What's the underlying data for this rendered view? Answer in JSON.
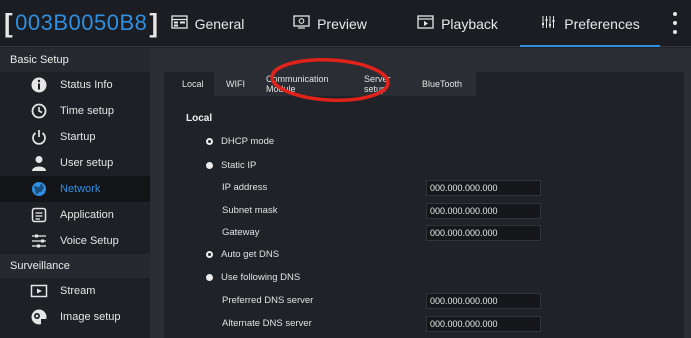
{
  "header": {
    "device_id": "003B0050B8",
    "tabs": [
      {
        "label": "General",
        "icon": "general-icon",
        "active": false
      },
      {
        "label": "Preview",
        "icon": "preview-icon",
        "active": false
      },
      {
        "label": "Playback",
        "icon": "playback-icon",
        "active": false
      },
      {
        "label": "Preferences",
        "icon": "preferences-icon",
        "active": true
      }
    ]
  },
  "sidebar": {
    "groups": [
      {
        "label": "Basic Setup",
        "items": [
          {
            "label": "Status Info",
            "icon": "info-icon"
          },
          {
            "label": "Time setup",
            "icon": "clock-icon"
          },
          {
            "label": "Startup",
            "icon": "power-icon"
          },
          {
            "label": "User setup",
            "icon": "user-icon"
          },
          {
            "label": "Network",
            "icon": "globe-icon",
            "active": true
          },
          {
            "label": "Application",
            "icon": "application-icon"
          },
          {
            "label": "Voice Setup",
            "icon": "sliders-icon"
          }
        ]
      },
      {
        "label": "Surveillance",
        "items": [
          {
            "label": "Stream",
            "icon": "stream-icon"
          },
          {
            "label": "Image setup",
            "icon": "image-setup-icon"
          }
        ]
      }
    ]
  },
  "main": {
    "subtabs": [
      "Local",
      "WIFI",
      "Communication Module",
      "Server setup",
      "BlueTooth"
    ],
    "active_subtab": "Local",
    "section_title": "Local",
    "options": {
      "dhcp": "DHCP mode",
      "static_ip": "Static IP",
      "auto_dns": "Auto get DNS",
      "following_dns": "Use following DNS"
    },
    "fields": {
      "ip_address": {
        "label": "IP address",
        "value": "000.000.000.000"
      },
      "subnet_mask": {
        "label": "Subnet mask",
        "value": "000.000.000.000"
      },
      "gateway": {
        "label": "Gateway",
        "value": "000.000.000.000"
      },
      "preferred_dns": {
        "label": "Preferred DNS server",
        "value": "000.000.000.000"
      },
      "alternate_dns": {
        "label": "Alternate DNS server",
        "value": "000.000.000.000"
      }
    }
  },
  "colors": {
    "accent": "#2f8fe0",
    "annotation": "#e0221b",
    "background": "#202328"
  }
}
